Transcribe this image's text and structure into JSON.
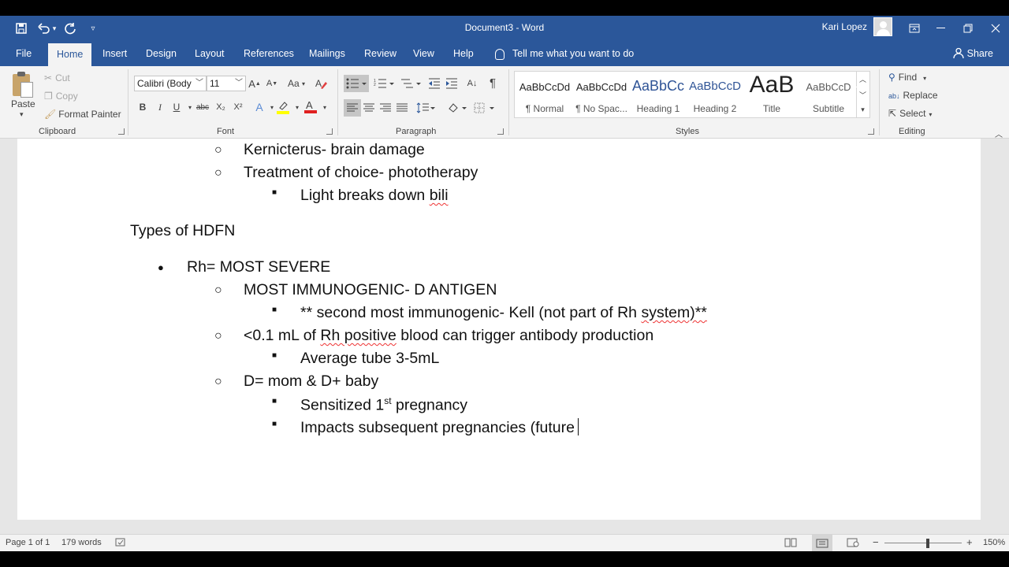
{
  "titlebar": {
    "doc_title": "Document3  -  Word",
    "user_name": "Kari Lopez"
  },
  "tabs": [
    {
      "label": "File",
      "active": false
    },
    {
      "label": "Home",
      "active": true
    },
    {
      "label": "Insert",
      "active": false
    },
    {
      "label": "Design",
      "active": false
    },
    {
      "label": "Layout",
      "active": false
    },
    {
      "label": "References",
      "active": false
    },
    {
      "label": "Mailings",
      "active": false
    },
    {
      "label": "Review",
      "active": false
    },
    {
      "label": "View",
      "active": false
    },
    {
      "label": "Help",
      "active": false
    }
  ],
  "tell_me": "Tell me what you want to do",
  "share": "Share",
  "clipboard": {
    "paste": "Paste",
    "cut": "Cut",
    "copy": "Copy",
    "format_painter": "Format Painter",
    "label": "Clipboard"
  },
  "font": {
    "name": "Calibri (Body",
    "size": "11",
    "label": "Font",
    "grow": "A",
    "shrink": "A",
    "case": "Aa",
    "bold": "B",
    "italic": "I",
    "underline": "U",
    "strike": "abc",
    "sub": "X₂",
    "sup": "X²",
    "color": "A"
  },
  "paragraph": {
    "label": "Paragraph",
    "sort": "A↓",
    "pilcrow": "¶"
  },
  "styles": {
    "label": "Styles",
    "items": [
      {
        "preview": "AaBbCcDd",
        "name": "¶ Normal"
      },
      {
        "preview": "AaBbCcDd",
        "name": "¶ No Spac..."
      },
      {
        "preview": "AaBbCc",
        "name": "Heading 1"
      },
      {
        "preview": "AaBbCcD",
        "name": "Heading 2"
      },
      {
        "preview": "AaB",
        "name": "Title"
      },
      {
        "preview": "AaBbCcD",
        "name": "Subtitle"
      }
    ]
  },
  "editing": {
    "label": "Editing",
    "find": "Find",
    "replace": "Replace",
    "select": "Select"
  },
  "document": {
    "l1": "Kernicterus- brain damage",
    "l2": "Treatment of choice- phototherapy",
    "l3a": "Light breaks down ",
    "l3b": "bili",
    "heading": "Types of HDFN",
    "l4": "Rh= MOST SEVERE",
    "l5": "MOST IMMUNOGENIC- D ANTIGEN",
    "l6a": "** second most immunogenic- Kell (not part of Rh ",
    "l6b": "system)**",
    "l7a": "<0.1 mL of ",
    "l7b": "Rh positive",
    "l7c": " blood can trigger antibody production",
    "l8": "Average tube 3-5mL",
    "l9": "D= mom & D+ baby",
    "l10a": "Sensitized 1",
    "l10sup": "st",
    "l10b": " pregnancy",
    "l11": "Impacts subsequent pregnancies (future"
  },
  "bullets": {
    "filled": "●",
    "hollow": "○",
    "square": "■"
  },
  "status": {
    "page": "Page 1 of 1",
    "words": "179 words",
    "zoom": "150%",
    "minus": "−",
    "plus": "+"
  },
  "colors": {
    "accent": "#2b579a"
  }
}
